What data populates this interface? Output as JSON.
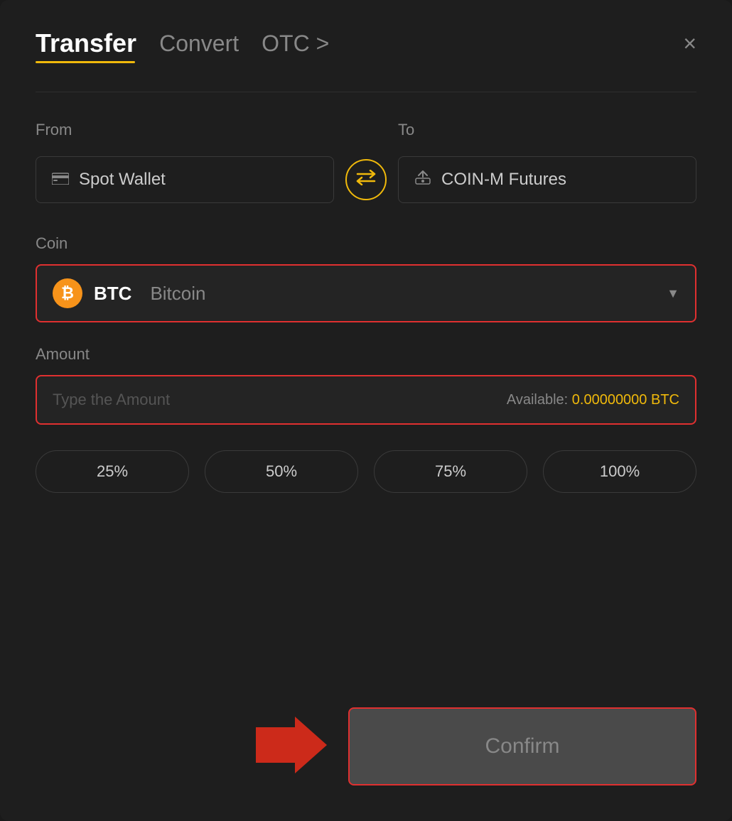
{
  "modal": {
    "title": "Transfer",
    "tabs": [
      {
        "label": "Transfer",
        "active": true
      },
      {
        "label": "Convert",
        "active": false
      },
      {
        "label": "OTC >",
        "active": false
      }
    ],
    "close_label": "×"
  },
  "from_section": {
    "label": "From",
    "wallet_label": "Spot Wallet"
  },
  "to_section": {
    "label": "To",
    "wallet_label": "COIN-M Futures"
  },
  "coin_section": {
    "label": "Coin",
    "coin_ticker": "BTC",
    "coin_name": "Bitcoin"
  },
  "amount_section": {
    "label": "Amount",
    "placeholder": "Type the Amount",
    "available_label": "Available:",
    "available_value": "0.00000000 BTC"
  },
  "percentage_buttons": [
    {
      "label": "25%"
    },
    {
      "label": "50%"
    },
    {
      "label": "75%"
    },
    {
      "label": "100%"
    }
  ],
  "confirm_button": {
    "label": "Confirm"
  }
}
